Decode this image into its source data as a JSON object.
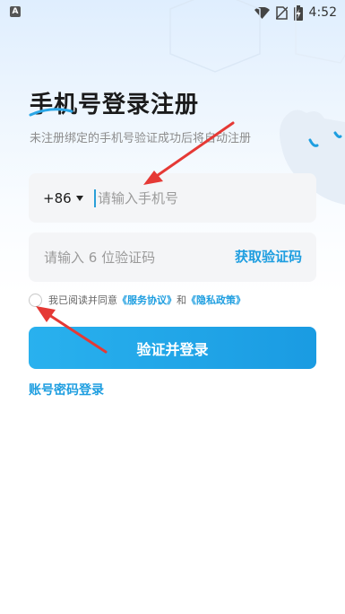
{
  "status_bar": {
    "app_icon_letter": "A",
    "time": "4:52",
    "icons": [
      "wifi-icon",
      "no-sim-icon",
      "battery-charging-icon"
    ]
  },
  "header": {
    "title": "手机号登录注册",
    "subtitle": "未注册绑定的手机号验证成功后将自动注册"
  },
  "phone_field": {
    "country_code": "+86",
    "placeholder": "请输入手机号",
    "value": ""
  },
  "code_field": {
    "placeholder": "请输入 6 位验证码",
    "value": "",
    "get_code_label": "获取验证码"
  },
  "agreement": {
    "checked": false,
    "prefix": "我已阅读并同意",
    "service_link": "《服务协议》",
    "and": "和",
    "privacy_link": "《隐私政策》"
  },
  "submit_label": "验证并登录",
  "alt_login_label": "账号密码登录",
  "colors": {
    "accent": "#1e9ee0",
    "button": "#22a7ea",
    "annotation_arrow": "#e53935"
  }
}
